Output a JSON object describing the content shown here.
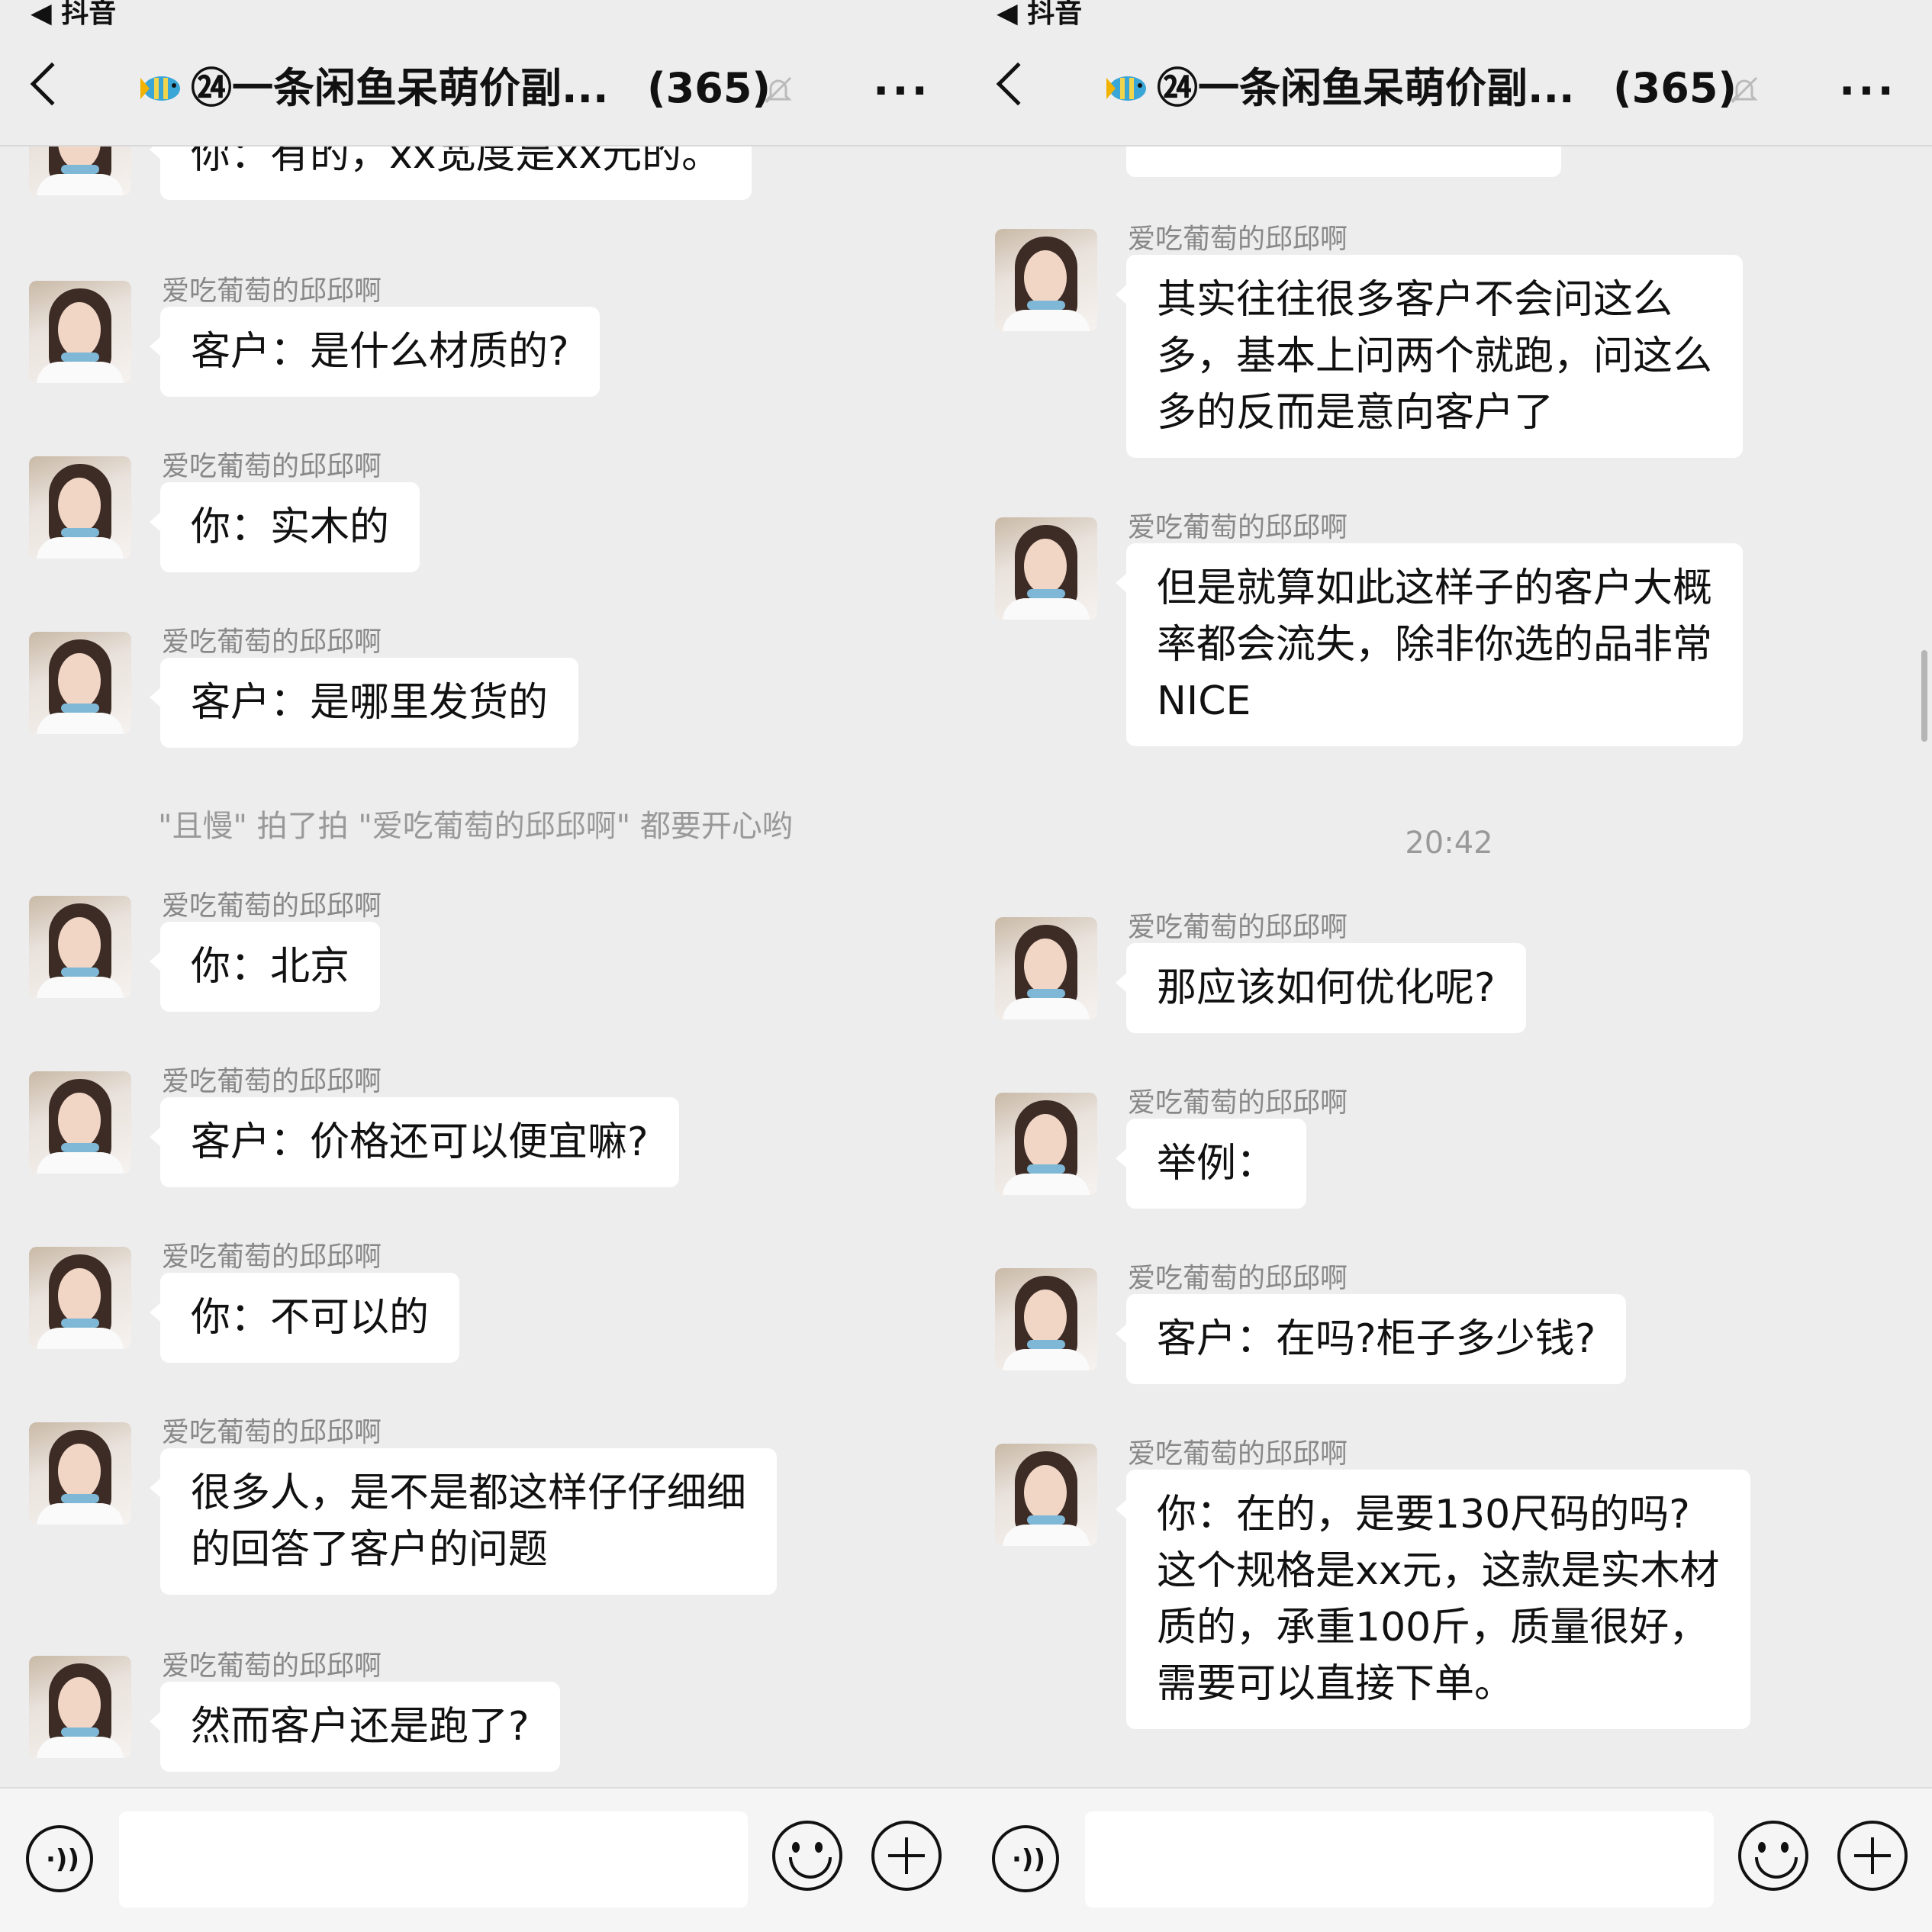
{
  "status": {
    "back_app": "◀ 抖音"
  },
  "header": {
    "back_icon": "‹",
    "title": "㉔一条闲鱼呆萌价副...",
    "count": "(365)",
    "more": "···"
  },
  "left": {
    "messages": [
      {
        "name": "",
        "text": "你：有的，xx宽度是xx元的。"
      },
      {
        "name": "爱吃葡萄的邱邱啊",
        "text": "客户：是什么材质的?"
      },
      {
        "name": "爱吃葡萄的邱邱啊",
        "text": "你：实木的"
      },
      {
        "name": "爱吃葡萄的邱邱啊",
        "text": "客户：是哪里发货的"
      },
      {
        "name": "爱吃葡萄的邱邱啊",
        "text": "你：北京"
      },
      {
        "name": "爱吃葡萄的邱邱啊",
        "text": "客户：价格还可以便宜嘛?"
      },
      {
        "name": "爱吃葡萄的邱邱啊",
        "text": "你：不可以的"
      },
      {
        "name": "爱吃葡萄的邱邱啊",
        "text": "很多人，是不是都这样仔仔细细\n的回答了客户的问题"
      },
      {
        "name": "爱吃葡萄的邱邱啊",
        "text": "然而客户还是跑了?"
      }
    ],
    "system_notice": "\"且慢\" 拍了拍 \"爱吃葡萄的邱邱啊\" 都要开心哟"
  },
  "right": {
    "messages": [
      {
        "name": "爱吃葡萄的邱邱啊",
        "text": "其实往往很多客户不会问这么\n多，基本上问两个就跑，问这么\n多的反而是意向客户了"
      },
      {
        "name": "爱吃葡萄的邱邱啊",
        "text": "但是就算如此这样子的客户大概\n率都会流失，除非你选的品非常\nNICE"
      },
      {
        "name": "爱吃葡萄的邱邱啊",
        "text": "那应该如何优化呢?"
      },
      {
        "name": "爱吃葡萄的邱邱啊",
        "text": "举例："
      },
      {
        "name": "爱吃葡萄的邱邱啊",
        "text": "客户：在吗?柜子多少钱?"
      },
      {
        "name": "爱吃葡萄的邱邱啊",
        "text": "你：在的，是要130尺码的吗?\n这个规格是xx元，这款是实木材\n质的，承重100斤，质量很好，\n需要可以直接下单。"
      }
    ],
    "timestamp": "20:42"
  },
  "inputbar": {
    "voice_icon": "voice-icon",
    "emoji_icon": "smile-icon",
    "plus_icon": "plus-icon"
  }
}
